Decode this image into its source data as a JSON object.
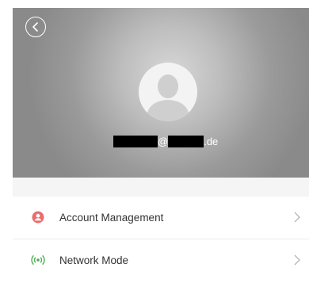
{
  "profile": {
    "email_suffix": ".de",
    "email_at": "@"
  },
  "menu": {
    "items": [
      {
        "label": "Account Management",
        "icon": "account-icon",
        "icon_color": "#e86e6e"
      },
      {
        "label": "Network Mode",
        "icon": "wifi-signal-icon",
        "icon_color": "#4caf50"
      }
    ]
  },
  "colors": {
    "header_bg": "#9a9a9a",
    "divider": "#ececec",
    "text": "#333333"
  }
}
